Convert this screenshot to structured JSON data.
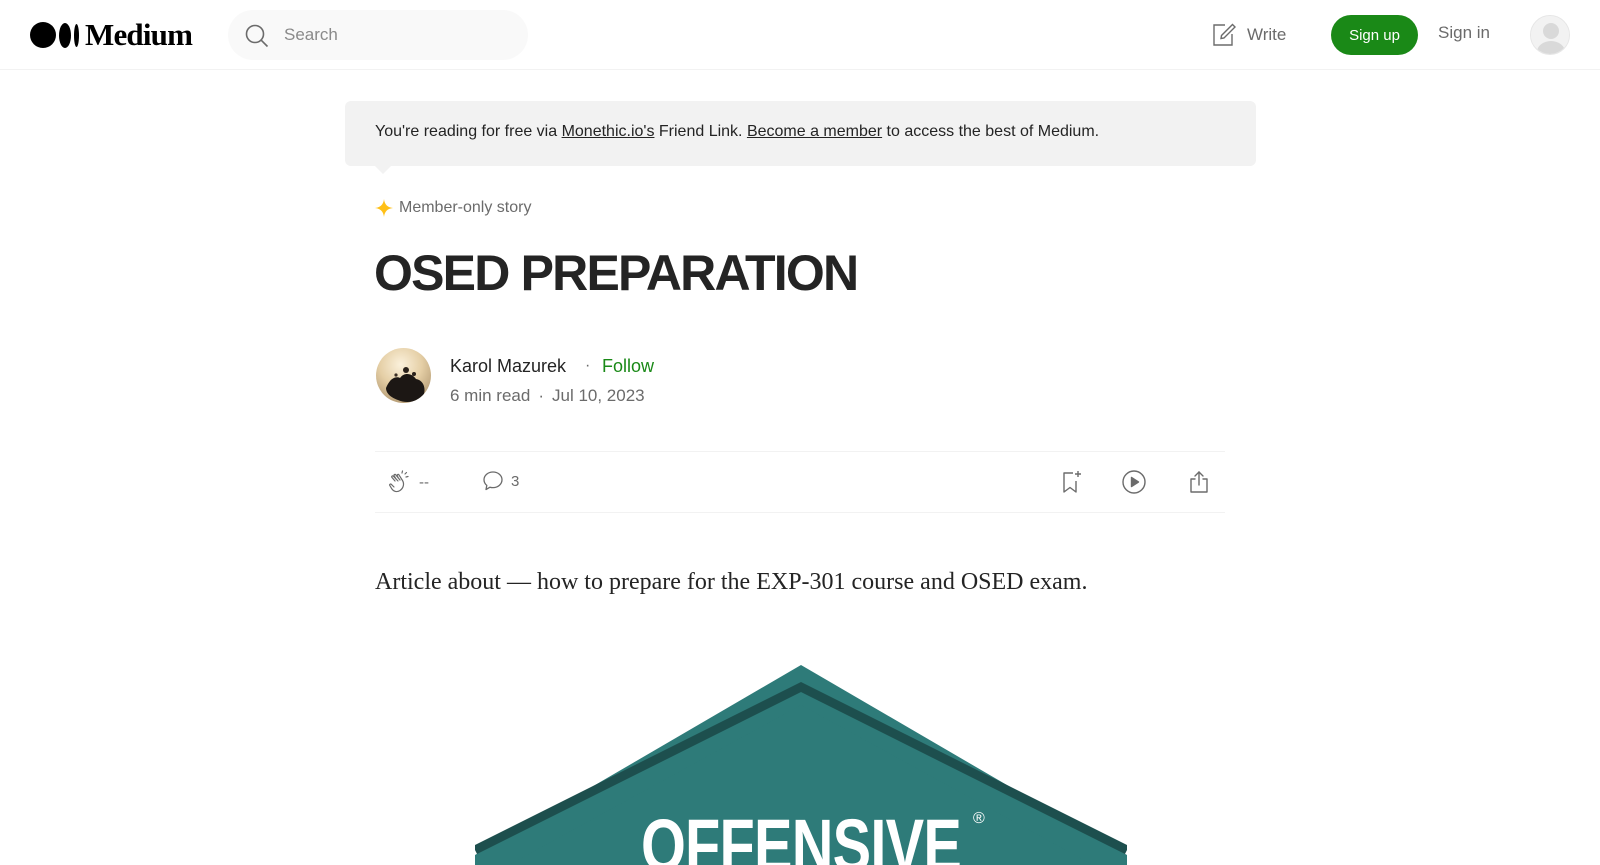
{
  "header": {
    "logo_text": "Medium",
    "search_placeholder": "Search",
    "write_label": "Write",
    "signup_label": "Sign up",
    "signin_label": "Sign in"
  },
  "banner": {
    "prefix": "You're reading for free via ",
    "friend_link": "Monethic.io's",
    "middle": " Friend Link. ",
    "member_link": "Become a member",
    "suffix": " to access the best of Medium."
  },
  "article": {
    "member_label": "Member-only story",
    "title": "OSED PREPARATION",
    "author": "Karol Mazurek",
    "follow_label": "Follow",
    "dot": "·",
    "read_time": "6 min read",
    "date": "Jul 10, 2023",
    "claps": "--",
    "responses": "3",
    "lede": "Article about — how to prepare for the EXP-301 course and OSED exam.",
    "image_text": "OFFENSIVE",
    "image_mark": "®"
  },
  "colors": {
    "accent_green": "#1a8917",
    "star": "#ffc017",
    "badge_teal": "#2e7b79",
    "badge_dark": "#1d4f4e"
  }
}
